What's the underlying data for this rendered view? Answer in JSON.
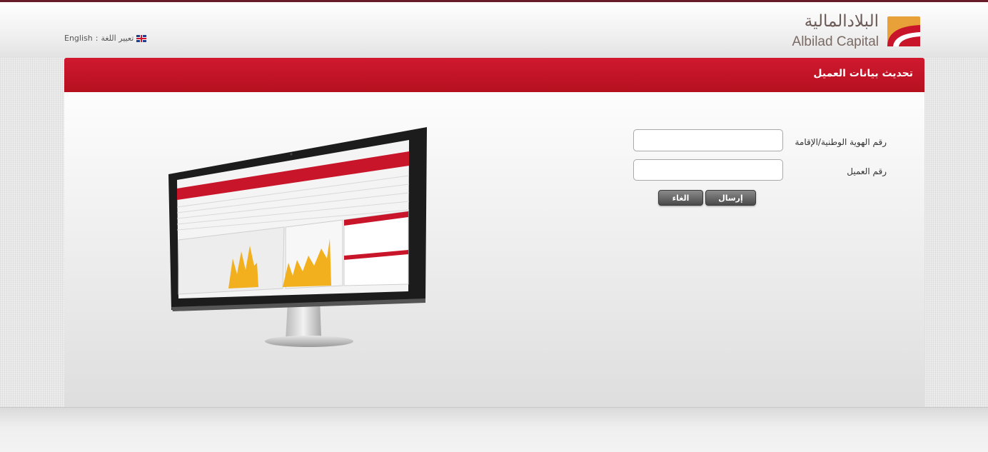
{
  "header": {
    "language_label": "تعيير اللغة",
    "language_separator": ":",
    "language_value": "English",
    "logo_text_ar": "البلادالمالية",
    "logo_text_en": "Albilad Capital",
    "flag_icon": "uk-flag-icon"
  },
  "page": {
    "title": "تحديث بيانات العميل"
  },
  "form": {
    "national_id_label": "رقم الهوية الوطنية/الإقامة",
    "national_id_value": "",
    "customer_number_label": "رقم العميل",
    "customer_number_value": "",
    "submit_label": "إرسال",
    "cancel_label": "الغاء"
  },
  "colors": {
    "brand_red": "#c8152a",
    "logo_orange": "#e79a2c",
    "button_dark": "#555555",
    "chart_fill": "#f2b01e"
  }
}
